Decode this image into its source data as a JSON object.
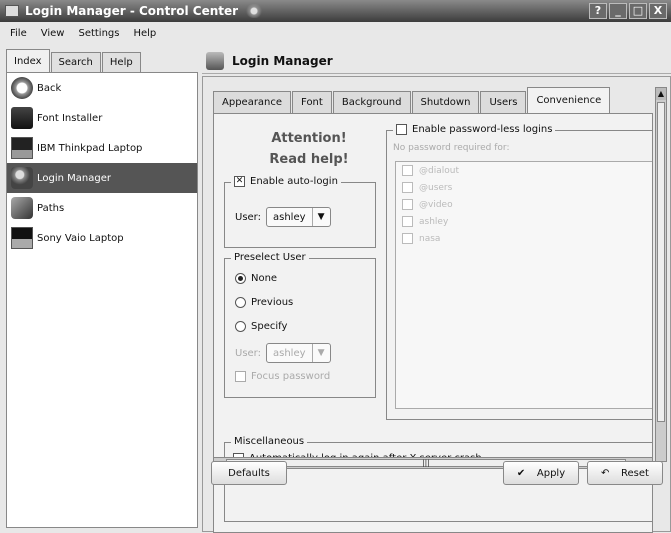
{
  "window": {
    "title": "Login Manager - Control Center",
    "buttons": [
      "?",
      "_",
      "□",
      "X"
    ]
  },
  "menubar": {
    "items": [
      {
        "label": "File"
      },
      {
        "label": "View"
      },
      {
        "label": "Settings"
      },
      {
        "label": "Help"
      }
    ]
  },
  "sidebar": {
    "tabs": [
      {
        "label": "Index"
      },
      {
        "label": "Search"
      },
      {
        "label": "Help"
      }
    ],
    "items": [
      {
        "label": "Back",
        "icon": "back-icon"
      },
      {
        "label": "Font Installer",
        "icon": "font-icon"
      },
      {
        "label": "IBM Thinkpad Laptop",
        "icon": "laptop-icon"
      },
      {
        "label": "Login Manager",
        "icon": "login-icon",
        "selected": true
      },
      {
        "label": "Paths",
        "icon": "paths-icon"
      },
      {
        "label": "Sony Vaio Laptop",
        "icon": "laptop-icon"
      }
    ]
  },
  "module": {
    "title": "Login Manager",
    "tabs": [
      {
        "label": "Appearance"
      },
      {
        "label": "Font"
      },
      {
        "label": "Background"
      },
      {
        "label": "Shutdown"
      },
      {
        "label": "Users"
      },
      {
        "label": "Convenience",
        "active": true
      }
    ]
  },
  "convenience": {
    "attention_line1": "Attention!",
    "attention_line2": "Read help!",
    "autologin_label": "Enable auto-login",
    "autologin_checked": true,
    "user_label": "User:",
    "user_value": "ashley",
    "preselect_title": "Preselect User",
    "preselect_none": "None",
    "preselect_previous": "Previous",
    "preselect_specify": "Specify",
    "preselect_user_label": "User:",
    "preselect_user_value": "ashley",
    "focus_password": "Focus password",
    "passwordless_label": "Enable password-less logins",
    "no_password_required_for": "No password required for:",
    "passwordless_users": [
      "@dialout",
      "@users",
      "@video",
      "ashley",
      "nasa"
    ],
    "misc_title": "Miscellaneous",
    "auto_relogin": "Automatically log in again after X server crash"
  },
  "footer": {
    "defaults": "Defaults",
    "apply": "Apply",
    "reset": "Reset"
  }
}
